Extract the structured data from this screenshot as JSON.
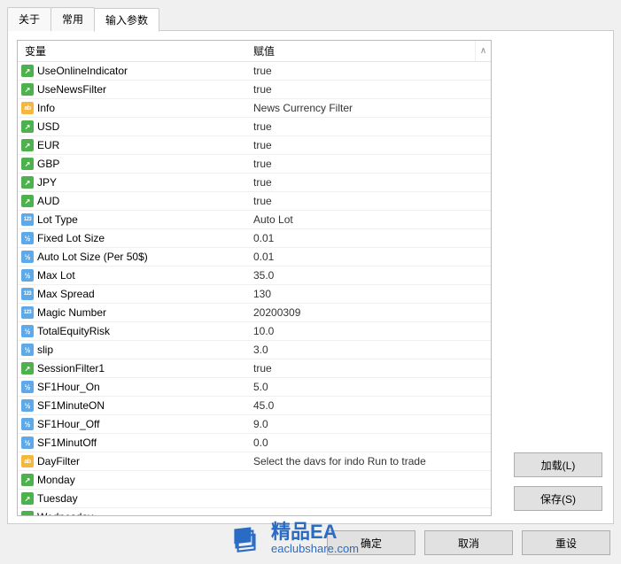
{
  "tabs": {
    "about": "关于",
    "common": "常用",
    "inputs": "输入参数"
  },
  "grid": {
    "header_var": "变量",
    "header_val": "赋值",
    "rows": [
      {
        "type": "bool",
        "name": "UseOnlineIndicator",
        "value": "true"
      },
      {
        "type": "bool",
        "name": "UseNewsFilter",
        "value": "true"
      },
      {
        "type": "str",
        "name": "Info",
        "value": "News Currency Filter"
      },
      {
        "type": "bool",
        "name": "USD",
        "value": "true"
      },
      {
        "type": "bool",
        "name": "EUR",
        "value": "true"
      },
      {
        "type": "bool",
        "name": "GBP",
        "value": "true"
      },
      {
        "type": "bool",
        "name": "JPY",
        "value": "true"
      },
      {
        "type": "bool",
        "name": "AUD",
        "value": "true"
      },
      {
        "type": "int",
        "name": "Lot Type",
        "value": "Auto Lot"
      },
      {
        "type": "dbl",
        "name": "Fixed Lot Size",
        "value": "0.01"
      },
      {
        "type": "dbl",
        "name": "Auto Lot Size (Per 50$)",
        "value": "0.01"
      },
      {
        "type": "dbl",
        "name": "Max Lot",
        "value": "35.0"
      },
      {
        "type": "int",
        "name": "Max Spread",
        "value": "130"
      },
      {
        "type": "int",
        "name": "Magic Number",
        "value": "20200309"
      },
      {
        "type": "dbl",
        "name": "TotalEquityRisk",
        "value": "10.0"
      },
      {
        "type": "dbl",
        "name": "slip",
        "value": "3.0"
      },
      {
        "type": "bool",
        "name": "SessionFilter1",
        "value": "true"
      },
      {
        "type": "dbl",
        "name": "SF1Hour_On",
        "value": "5.0"
      },
      {
        "type": "dbl",
        "name": "SF1MinuteON",
        "value": "45.0"
      },
      {
        "type": "dbl",
        "name": "SF1Hour_Off",
        "value": "9.0"
      },
      {
        "type": "dbl",
        "name": "SF1MinutOff",
        "value": "0.0"
      },
      {
        "type": "str",
        "name": "DayFilter",
        "value": "Select the davs for indo Run to trade"
      },
      {
        "type": "bool",
        "name": "Monday",
        "value": ""
      },
      {
        "type": "bool",
        "name": "Tuesday",
        "value": ""
      },
      {
        "type": "bool",
        "name": "Wednesday",
        "value": ""
      }
    ]
  },
  "buttons": {
    "load": "加载(L)",
    "save": "保存(S)",
    "ok": "确定",
    "cancel": "取消",
    "reset": "重设"
  },
  "watermark": {
    "main": "精品EA",
    "sub": "eaclubshare.com"
  }
}
